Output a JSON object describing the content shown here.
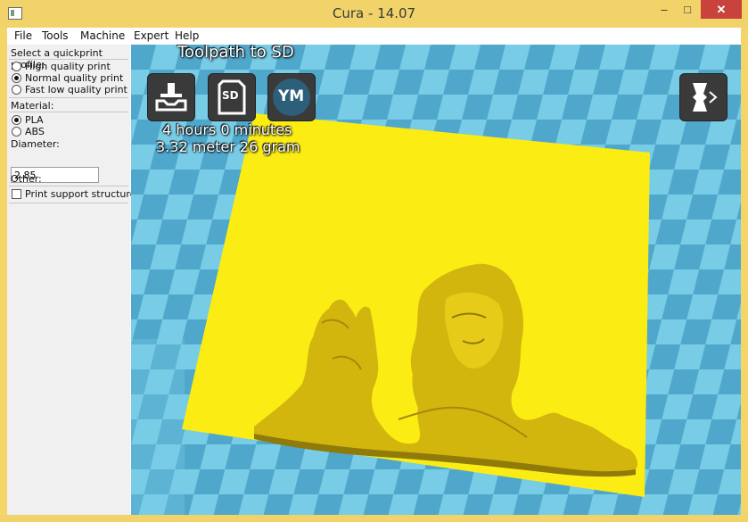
{
  "window": {
    "title": "Cura - 14.07",
    "min_glyph": "–",
    "max_glyph": "□",
    "close_glyph": "✕"
  },
  "menu": [
    "File",
    "Tools",
    "Machine",
    "Expert",
    "Help"
  ],
  "sidebar": {
    "profile_label": "Select a quickprint profile:",
    "profiles": [
      {
        "label": "High quality print",
        "selected": false
      },
      {
        "label": "Normal quality print",
        "selected": true
      },
      {
        "label": "Fast low quality print",
        "selected": false
      }
    ],
    "material_label": "Material:",
    "materials": [
      {
        "label": "PLA",
        "selected": true
      },
      {
        "label": "ABS",
        "selected": false
      }
    ],
    "diameter_label": "Diameter:",
    "diameter_value": "2.85",
    "other_label": "Other:",
    "support_label": "Print support structure",
    "support_checked": false
  },
  "viewport": {
    "toolpath_title": "Toolpath to SD",
    "time_text": "4 hours 0 minutes",
    "material_text": "3.32 meter 26 gram",
    "sd_label": "SD",
    "ym_label": "YM",
    "colors": {
      "sky": "#78cce6",
      "tile_dark": "#4fa7cb",
      "plate": "#fbec14",
      "model": "#d2b60e"
    }
  }
}
